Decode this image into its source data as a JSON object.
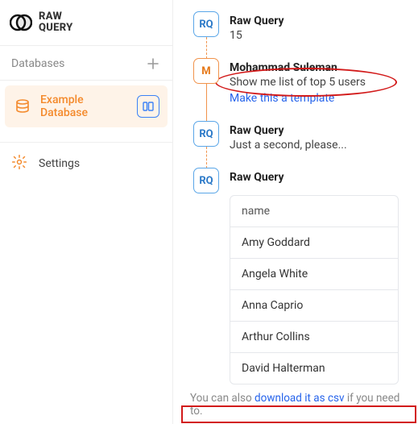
{
  "brand": {
    "line1": "RAW",
    "line2": "QUERY"
  },
  "sidebar": {
    "databases_label": "Databases",
    "item_label": "Example Database",
    "settings_label": "Settings"
  },
  "messages": [
    {
      "avatar": "RQ",
      "name": "Raw Query",
      "text": "15"
    },
    {
      "avatar": "M",
      "name": "Mohammad Suleman",
      "text": "Show me list of top 5 users",
      "template_link": "Make this a template"
    },
    {
      "avatar": "RQ",
      "name": "Raw Query",
      "text": "Just a second, please..."
    },
    {
      "avatar": "RQ",
      "name": "Raw Query",
      "text": ""
    }
  ],
  "table": {
    "header": "name",
    "rows": [
      "Amy Goddard",
      "Angela White",
      "Anna Caprio",
      "Arthur Collins",
      "David Halterman"
    ]
  },
  "footer": {
    "prefix": "You can also ",
    "link": "download it as csv",
    "suffix": " if you need to."
  }
}
